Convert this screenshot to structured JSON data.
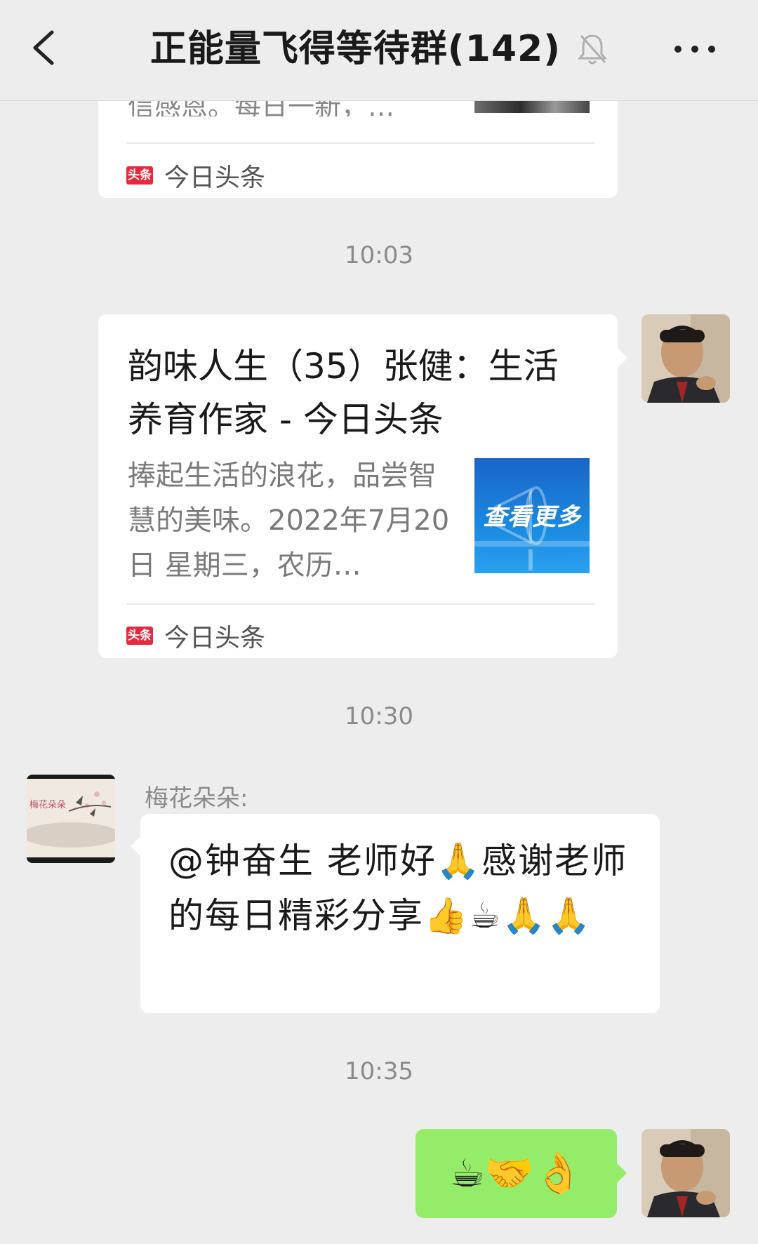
{
  "header": {
    "title": "正能量飞得等待群(142)",
    "back_icon": "chevron-left-icon",
    "mute_icon": "bell-off-icon",
    "more_icon": "more-icon"
  },
  "messages": {
    "top_card": {
      "partial_text": "信感恩。每日一新，…",
      "source_logo": "头条",
      "source_name": "今日头条"
    },
    "time_1": "10:03",
    "article_card": {
      "title": "韵味人生（35）张健：生活养育作家 - 今日头条",
      "description": "捧起生活的浪花，品尝智慧的美味。2022年7月20日 星期三，农历…",
      "thumb_label": "查看更多",
      "source_logo": "头条",
      "source_name": "今日头条"
    },
    "time_2": "10:30",
    "incoming": {
      "sender": "梅花朵朵:",
      "text": "@钟奋生  老师好🙏感谢老师的每日精彩分享👍☕🙏🙏",
      "avatar_text": "梅花朵朵"
    },
    "time_3": "10:35",
    "outgoing": {
      "text": "☕🤝👌"
    }
  },
  "colors": {
    "background": "#ededed",
    "bubble_green": "#95ec69",
    "toutiao_red": "#e8283e"
  }
}
